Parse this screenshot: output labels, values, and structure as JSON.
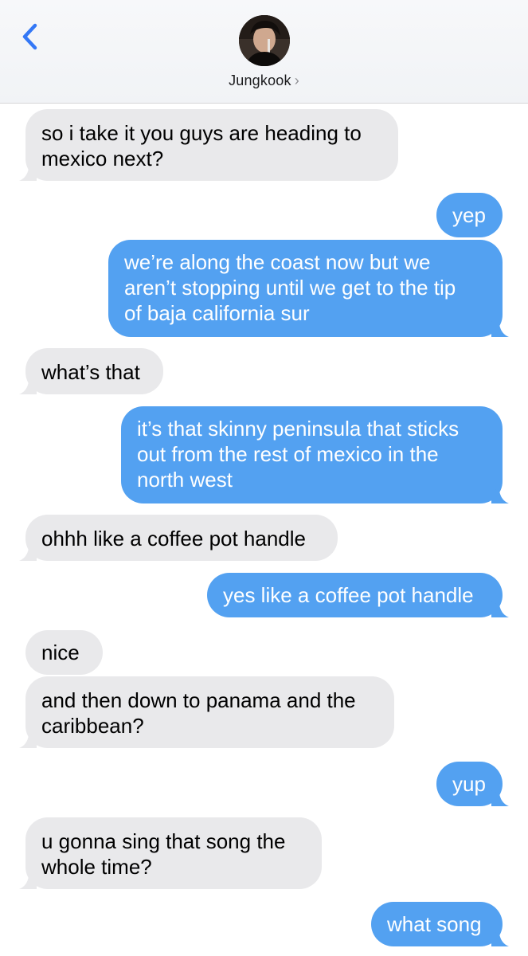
{
  "header": {
    "contact_name": "Jungkook",
    "chevron": "›",
    "back_icon": "chevron-left-icon",
    "accent_color": "#3478f6"
  },
  "colors": {
    "incoming_bubble": "#e9e9eb",
    "outgoing_bubble": "#53a1f1"
  },
  "messages": [
    {
      "direction": "incoming",
      "lines": [
        "so i take it you guys are heading to",
        "mexico next?"
      ]
    },
    {
      "direction": "outgoing",
      "lines": [
        "yep"
      ]
    },
    {
      "direction": "outgoing",
      "lines": [
        "we’re along the coast now but we",
        "aren’t stopping until we get to the tip",
        "of baja california sur"
      ]
    },
    {
      "direction": "incoming",
      "lines": [
        "what’s that"
      ]
    },
    {
      "direction": "outgoing",
      "lines": [
        "it’s that skinny peninsula that sticks",
        "out from the rest of mexico in the",
        "north west"
      ]
    },
    {
      "direction": "incoming",
      "lines": [
        "ohhh like a coffee pot handle"
      ]
    },
    {
      "direction": "outgoing",
      "lines": [
        "yes like a coffee pot handle"
      ]
    },
    {
      "direction": "incoming",
      "lines": [
        "nice"
      ]
    },
    {
      "direction": "incoming",
      "lines": [
        "and then down to panama and the",
        "caribbean?"
      ]
    },
    {
      "direction": "outgoing",
      "lines": [
        "yup"
      ]
    },
    {
      "direction": "incoming",
      "lines": [
        "u gonna sing that song the",
        "whole time?"
      ]
    },
    {
      "direction": "outgoing",
      "lines": [
        "what song"
      ]
    }
  ]
}
